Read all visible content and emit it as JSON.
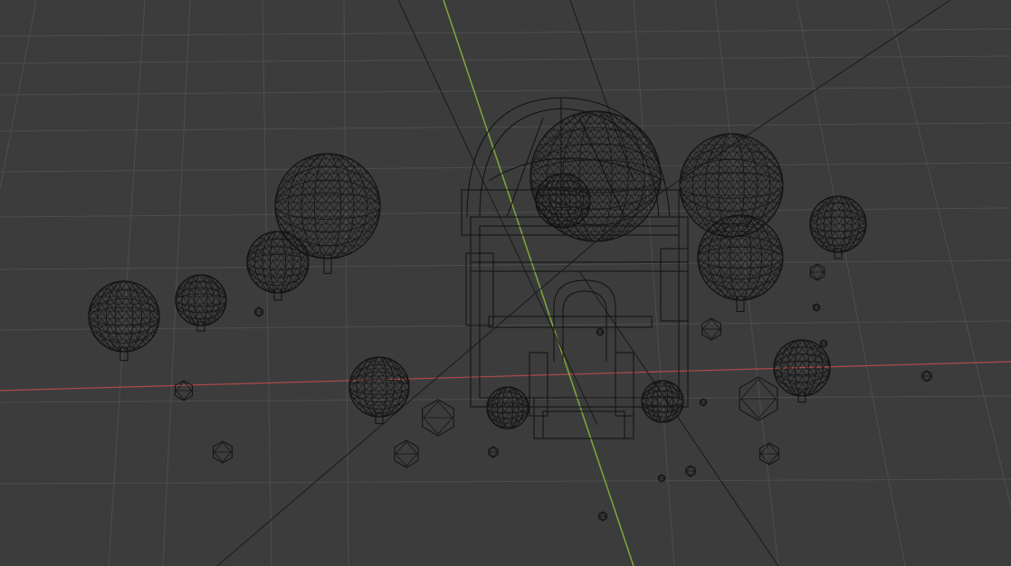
{
  "viewport": {
    "mode": "wireframe",
    "background_color": "#3c3c3c",
    "grid_color": "#4e4e4e",
    "wire_color": "#111111",
    "x_axis_color": "#b04a4a",
    "y_axis_color": "#7fa83a"
  },
  "scene": {
    "objects": [
      "house",
      "dome",
      "trees",
      "rocks",
      "ground-grid"
    ]
  }
}
